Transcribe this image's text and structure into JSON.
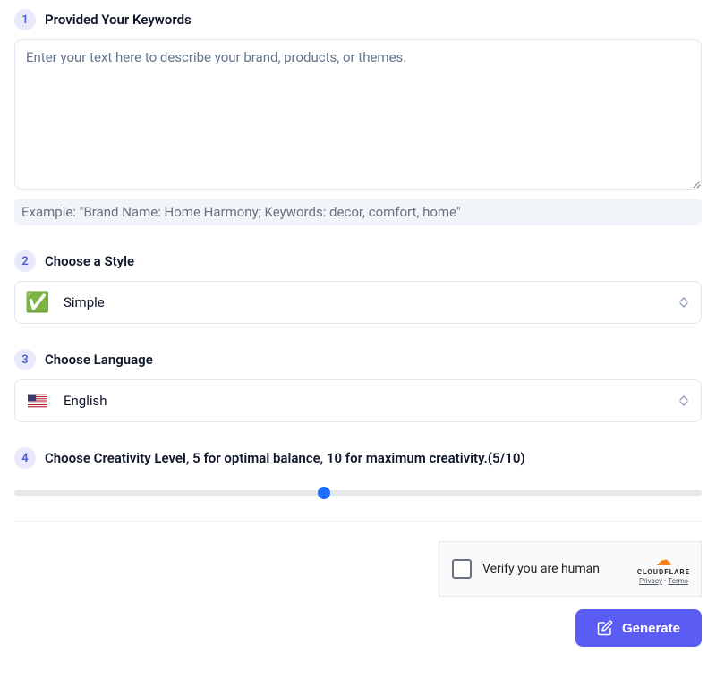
{
  "steps": {
    "keywords": {
      "number": "1",
      "title": "Provided Your Keywords",
      "placeholder": "Enter your text here to describe your brand, products, or themes.",
      "example_prefix": "Example:",
      "example_text": "  \"Brand Name: Home Harmony; Keywords: decor, comfort, home\""
    },
    "style": {
      "number": "2",
      "title": "Choose a Style",
      "selected": "Simple"
    },
    "language": {
      "number": "3",
      "title": "Choose Language",
      "selected": "English"
    },
    "creativity": {
      "number": "4",
      "title": "Choose Creativity Level, 5 for optimal balance, 10 for maximum creativity.(5/10)",
      "value": 5,
      "min": 1,
      "max": 10,
      "thumb_left_percent": "45%"
    }
  },
  "captcha": {
    "label": "Verify you are human",
    "brand": "CLOUDFLARE",
    "privacy": "Privacy",
    "terms": "Terms"
  },
  "buttons": {
    "generate": "Generate"
  }
}
